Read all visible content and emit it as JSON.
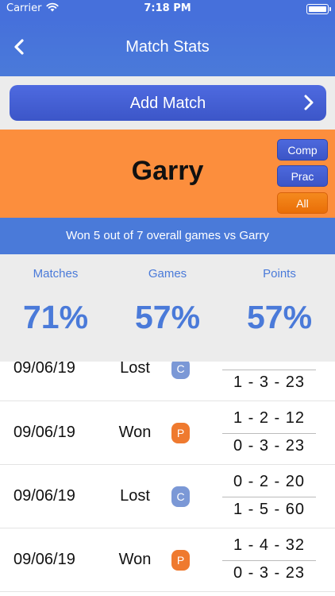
{
  "status_bar": {
    "carrier": "Carrier",
    "time": "7:18 PM"
  },
  "nav": {
    "title": "Match Stats",
    "back_icon": "chevron-left-icon"
  },
  "add_match": {
    "label": "Add Match",
    "icon": "chevron-right-icon"
  },
  "opponent": {
    "name": "Garry"
  },
  "filters": [
    {
      "label": "Comp",
      "selected": false
    },
    {
      "label": "Prac",
      "selected": false
    },
    {
      "label": "All",
      "selected": true
    }
  ],
  "summary": "Won 5 out of 7 overall games vs Garry",
  "stats": [
    {
      "label": "Matches",
      "value": "71%"
    },
    {
      "label": "Games",
      "value": "57%"
    },
    {
      "label": "Points",
      "value": "57%"
    }
  ],
  "matches": [
    {
      "date": "09/06/19",
      "result": "Lost",
      "type": "C",
      "score_top": "",
      "score_bottom": "1 - 3 - 23"
    },
    {
      "date": "09/06/19",
      "result": "Won",
      "type": "P",
      "score_top": "1 - 2 - 12",
      "score_bottom": "0 - 3 - 23"
    },
    {
      "date": "09/06/19",
      "result": "Lost",
      "type": "C",
      "score_top": "0 - 2 - 20",
      "score_bottom": "1 - 5 - 60"
    },
    {
      "date": "09/06/19",
      "result": "Won",
      "type": "P",
      "score_top": "1 - 4 - 32",
      "score_bottom": "0 - 3 - 23"
    }
  ],
  "colors": {
    "header_blue": "#4670db",
    "accent_blue": "#4a7ad9",
    "opponent_orange": "#fc8e3d",
    "competitive_badge": "#7b98d6",
    "practice_badge": "#ef7a2f"
  }
}
